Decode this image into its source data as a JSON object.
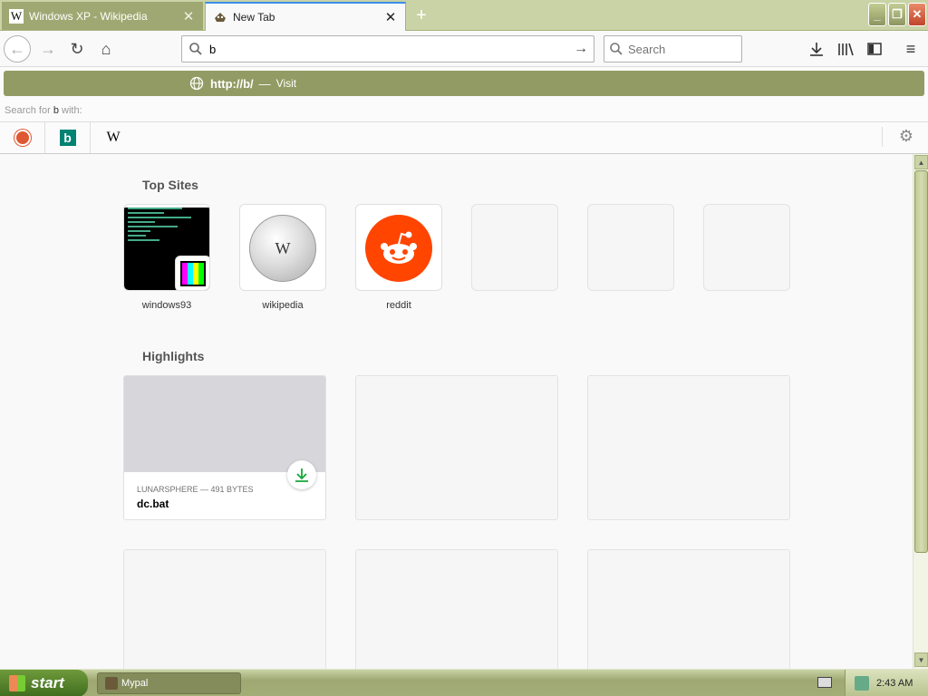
{
  "tabs": [
    {
      "favicon": "W",
      "title": "Windows XP - Wikipedia",
      "close": "✕"
    },
    {
      "favicon": "",
      "title": "New Tab",
      "close": "✕"
    }
  ],
  "new_tab": "+",
  "window_buttons": {
    "minimize": "_",
    "maximize": "❐",
    "close": "✕"
  },
  "nav": {
    "back": "←",
    "forward": "→",
    "reload": "↻",
    "home": "⌂",
    "url_value": "b",
    "go": "→",
    "search_placeholder": "Search",
    "downloads": "⤓",
    "library": "|||\\",
    "sidebar": "◫",
    "menu": "≡"
  },
  "suggestion": {
    "url": "http://b/",
    "sep": "—",
    "action": "Visit"
  },
  "search_for": {
    "prefix": "Search for",
    "query": "b",
    "suffix": "with:"
  },
  "engines": {
    "bing_letter": "b",
    "wiki_letter": "W"
  },
  "settings_icon": "⚙",
  "top_sites": {
    "title": "Top Sites",
    "items": [
      {
        "label": "windows93"
      },
      {
        "label": "wikipedia"
      },
      {
        "label": "reddit"
      }
    ]
  },
  "highlights": {
    "title": "Highlights",
    "card": {
      "meta": "LUNARSPHERE — 491 BYTES",
      "title": "dc.bat"
    }
  },
  "taskbar": {
    "start": "start",
    "task": "Mypal",
    "clock": "2:43 AM"
  }
}
